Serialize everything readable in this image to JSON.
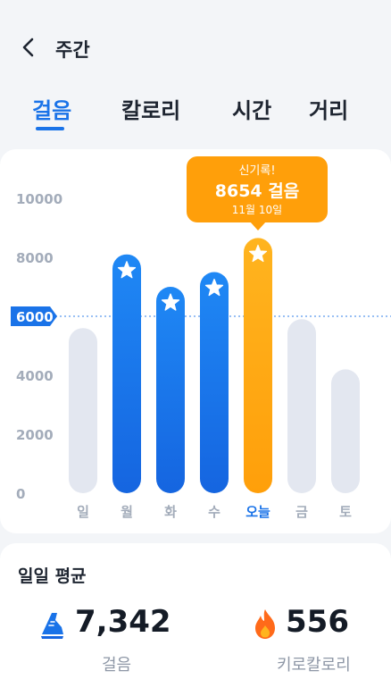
{
  "header": {
    "title": "주간"
  },
  "tabs": [
    {
      "label": "걸음",
      "active": true
    },
    {
      "label": "칼로리",
      "active": false
    },
    {
      "label": "시간",
      "active": false
    },
    {
      "label": "거리",
      "active": false
    }
  ],
  "chart_data": {
    "type": "bar",
    "categories": [
      "일",
      "월",
      "화",
      "수",
      "오늘",
      "금",
      "토"
    ],
    "values": [
      5600,
      8100,
      7000,
      7500,
      8654,
      5900,
      4200
    ],
    "highlight_index": 4,
    "record_days": [
      1,
      2,
      3,
      4
    ],
    "goal_line": 6000,
    "goal_label": "6000",
    "ylim": [
      0,
      10000
    ],
    "yticks": [
      0,
      2000,
      4000,
      6000,
      8000,
      10000
    ],
    "ytick_labels": [
      "0",
      "2000",
      "4000",
      "",
      "8000",
      "10000"
    ],
    "grid": false,
    "tooltip": {
      "title": "신기록!",
      "value": "8654 걸음",
      "date": "11월 10일"
    },
    "colors": {
      "goal_met": "#1a73e8",
      "goal_met_light": "#1f88f5",
      "below_goal": "#e3e7f0",
      "today": "#ffae1a",
      "today_dark": "#ff9f0a",
      "axis_text": "#a3acba",
      "goal_badge": "#1a73e8"
    }
  },
  "summary": {
    "title": "일일 평균",
    "steps_value": "7,342",
    "steps_label": "걸음",
    "steps_icon": "shoe-icon",
    "calories_value": "556",
    "calories_label": "키로칼로리",
    "calories_icon": "flame-icon"
  }
}
